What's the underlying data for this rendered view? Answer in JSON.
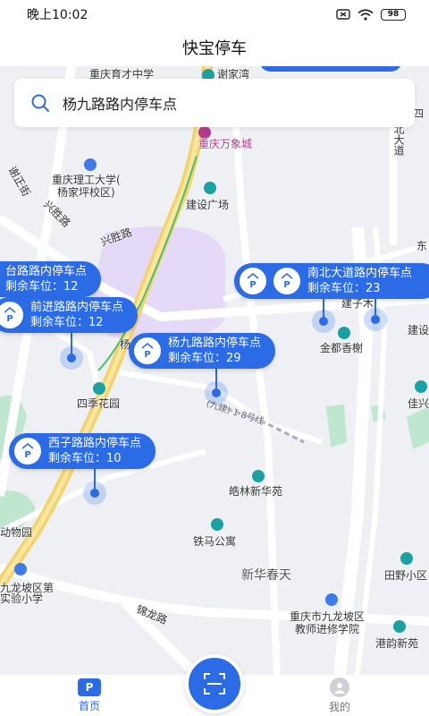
{
  "status": {
    "time": "晚上10:02",
    "battery": "98"
  },
  "header": {
    "title": "快宝停车"
  },
  "search": {
    "value": "杨九路路内停车点"
  },
  "map_labels": {
    "yucai": "重庆育才中学",
    "xiejiawan": "谢家湾",
    "wanxiangcheng": "重庆万象城",
    "ligong": "重庆理工大学(",
    "ligong2": "杨家坪校区)",
    "jianshe": "建设广场",
    "xingsheng": "兴胜路",
    "xingsheng2": "兴胜路",
    "siji": "四季花园",
    "jindu": "金都香榭",
    "jianzi": "建子木",
    "jianshe2": "建设",
    "haolin": "皓林新华苑",
    "tiema": "铁马公寓",
    "xinhua": "新华春天",
    "jiulongpo": "九龙坡区第",
    "shiyan": "实验小学",
    "zoo": "动物园",
    "jinlong": "锦龙路",
    "jiaoshi": "重庆市九龙坡区",
    "jiaoshi2": "教师进修学院",
    "tianye": "田野小区",
    "gangyun": "港韵新苑",
    "jiahua": "佳兴",
    "dong": "东",
    "road1": "(九建)·1·8号线",
    "yang": "杨",
    "si": "四",
    "nan": "北大道",
    "xiecheng": "谢正街"
  },
  "parking": [
    {
      "name": "台路路内停车点",
      "remaining": "剩余车位：12"
    },
    {
      "name": "前进路路内停车点",
      "remaining": "剩余车位：12"
    },
    {
      "name": "杨九路路内停车点",
      "remaining": "剩余车位：29"
    },
    {
      "name": "南北大道路内停车点",
      "remaining": "剩余车位：23"
    },
    {
      "name": "西子路路内停车点",
      "remaining": "剩余车位：10"
    }
  ],
  "tabs": {
    "home": "首页",
    "mine": "我的"
  },
  "colors": {
    "accent": "#2b6be6",
    "district": "#e4d9f7",
    "road_yellow": "#f3d36b"
  }
}
